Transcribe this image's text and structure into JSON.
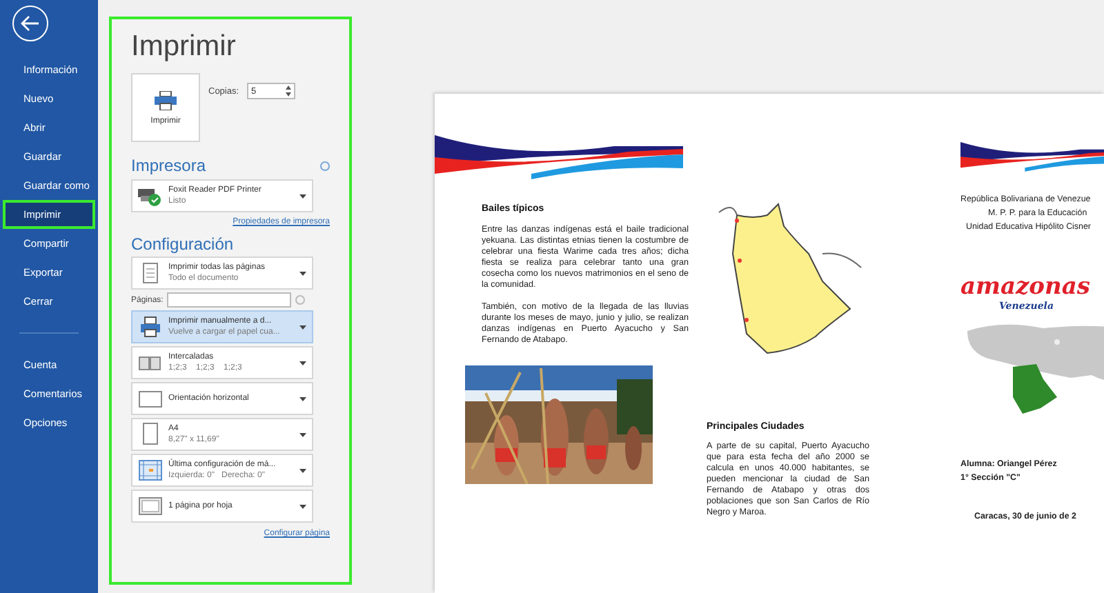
{
  "sidebar": {
    "items": [
      {
        "label": "Información",
        "selected": false
      },
      {
        "label": "Nuevo",
        "selected": false
      },
      {
        "label": "Abrir",
        "selected": false
      },
      {
        "label": "Guardar",
        "selected": false
      },
      {
        "label": "Guardar como",
        "selected": false
      },
      {
        "label": "Imprimir",
        "selected": true
      },
      {
        "label": "Compartir",
        "selected": false
      },
      {
        "label": "Exportar",
        "selected": false
      },
      {
        "label": "Cerrar",
        "selected": false
      }
    ],
    "bottom_items": [
      {
        "label": "Cuenta",
        "selected": false
      },
      {
        "label": "Comentarios",
        "selected": false
      },
      {
        "label": "Opciones",
        "selected": false
      }
    ]
  },
  "print_panel": {
    "title": "Imprimir",
    "print_button": "Imprimir",
    "copies_label": "Copias:",
    "copies": "5",
    "printer_heading": "Impresora",
    "printer": {
      "name": "Foxit Reader PDF Printer",
      "status": "Listo"
    },
    "printer_link": "Propiedades de impresora",
    "settings_heading": "Configuración",
    "pages_label": "Páginas:",
    "settings": [
      {
        "kind": "pages",
        "line1": "Imprimir todas las páginas",
        "line2": "Todo el documento",
        "selected": false
      },
      {
        "kind": "manual",
        "line1": "Imprimir manualmente a d...",
        "line2": "Vuelve a cargar el papel cua...",
        "selected": true
      },
      {
        "kind": "collate",
        "line1": "Intercaladas",
        "line2": "1;2;3    1;2;3    1;2;3",
        "selected": false
      },
      {
        "kind": "orientation",
        "line1": "Orientación horizontal",
        "selected": false
      },
      {
        "kind": "paper",
        "line1": "A4",
        "line2": "8,27\" x 11,69\"",
        "selected": false
      },
      {
        "kind": "margins",
        "line1": "Última configuración de má...",
        "line2": "Izquierda: 0\"   Derecha: 0\"",
        "selected": false
      },
      {
        "kind": "persheet",
        "line1": "1 página por hoja",
        "selected": false
      }
    ],
    "setup_link": "Configurar página"
  },
  "preview": {
    "column_1": {
      "heading": "Bailes típicos",
      "paragraphs": [
        "Entre las danzas indígenas está el baile tradicional yekuana. Las distintas etnias tienen la costumbre de celebrar una fiesta Warime cada tres años; dicha fiesta se realiza para celebrar tanto una gran cosecha como los nuevos matrimonios en el seno de la comunidad.",
        "También, con motivo de la llegada de las lluvias durante los meses de mayo, junio y julio, se realizan danzas indígenas en Puerto Ayacucho y San Fernando de Atabapo."
      ]
    },
    "column_2": {
      "heading": "Principales Ciudades",
      "paragraph": "A parte de su capital, Puerto Ayacucho que para esta fecha del año 2000 se calcula en unos 40.000 habitantes, se pueden mencionar la ciudad de San Fernando de Atabapo y otras dos poblaciones que son San Carlos de Río Negro y Maroa."
    },
    "column_3": {
      "header_lines": [
        "República Bolivariana de Venezue",
        "M. P. P. para la Educación",
        "Unidad Educativa Hipólito Cisner"
      ],
      "logo_title": "amazonas",
      "logo_subtitle": "Venezuela",
      "student_lines": [
        "Alumna: Oriangel Pérez",
        "1° Sección \"C\""
      ],
      "date": "Caracas, 30 de junio de 2"
    }
  }
}
